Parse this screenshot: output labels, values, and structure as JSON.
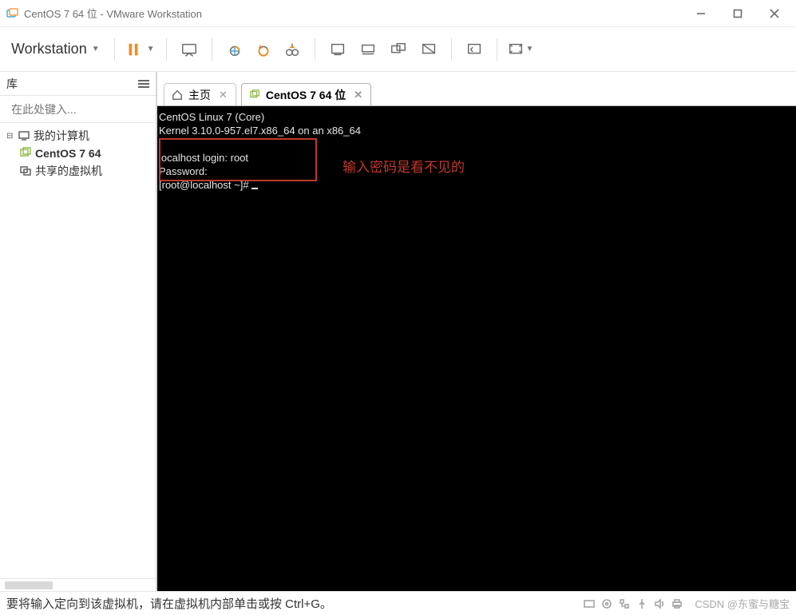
{
  "window": {
    "title": "CentOS 7 64 位 - VMware Workstation"
  },
  "menubar": {
    "workstation_label": "Workstation"
  },
  "library": {
    "header": "库",
    "search_placeholder": "在此处键入...",
    "root_label": "我的计算机",
    "vm_label": "CentOS 7 64",
    "shared_label": "共享的虚拟机"
  },
  "tabs": {
    "home_label": "主页",
    "vm_label": "CentOS 7 64 位"
  },
  "terminal": {
    "line1": "CentOS Linux 7 (Core)",
    "line2": "Kernel 3.10.0-957.el7.x86_64 on an x86_64",
    "line3": "",
    "line4": "localhost login: root",
    "line5": "Password:",
    "line6": "[root@localhost ~]# "
  },
  "annotation": {
    "text": "输入密码是看不见的"
  },
  "statusbar": {
    "hint": "要将输入定向到该虚拟机，请在虚拟机内部单击或按 Ctrl+G。",
    "watermark": "CSDN @东蜜与糖宝"
  }
}
